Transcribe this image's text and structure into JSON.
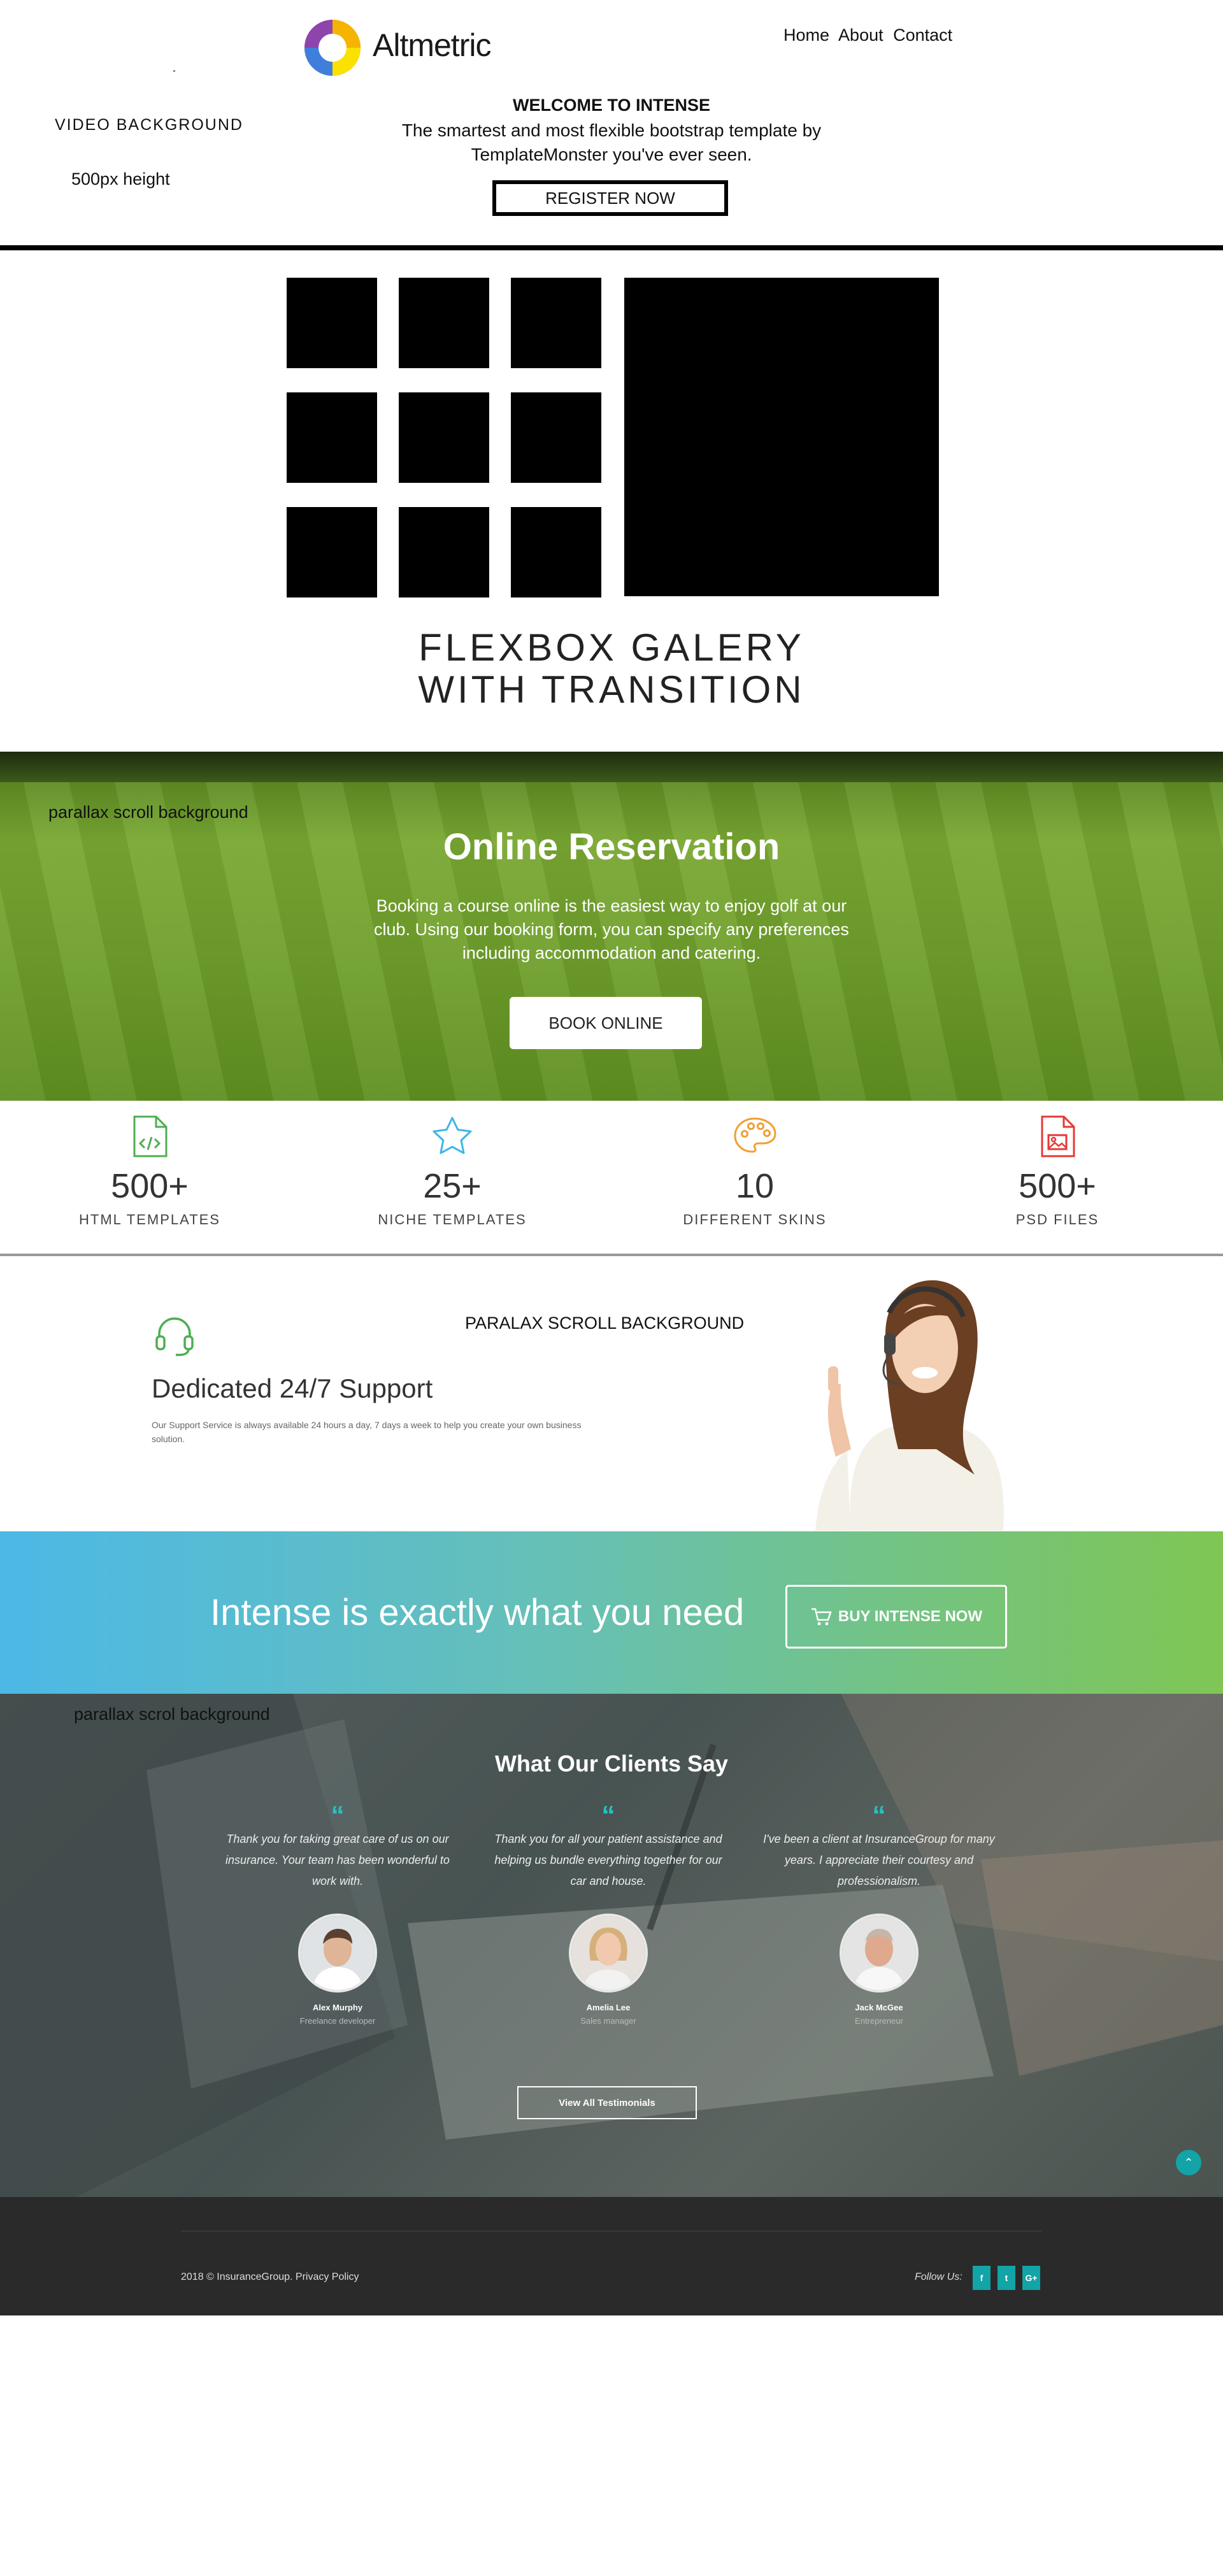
{
  "header": {
    "logo_text": "Altmetric",
    "nav": [
      "Home",
      "About",
      "Contact"
    ]
  },
  "hero": {
    "title": "WELCOME TO INTENSE",
    "subtitle": "The smartest and most flexible bootstrap template by TemplateMonster you've ever seen.",
    "register_label": "REGISTER NOW",
    "video_label": "VIDEO BACKGROUND",
    "height_label": "500px height"
  },
  "gallery": {
    "title_line1": "FLEXBOX GALERY",
    "title_line2": "WITH TRANSITION"
  },
  "reservation": {
    "note": "parallax scroll background",
    "title": "Online Reservation",
    "text": "Booking a course online is the easiest way to enjoy golf at our club. Using our booking form, you can specify any preferences including accommodation and catering.",
    "button_label": "BOOK ONLINE"
  },
  "stats": [
    {
      "icon": "code-file-icon",
      "value": "500+",
      "label": "HTML TEMPLATES",
      "color": "#4caf50"
    },
    {
      "icon": "star-icon",
      "value": "25+",
      "label": "NICHE TEMPLATES",
      "color": "#3fb5e5"
    },
    {
      "icon": "palette-icon",
      "value": "10",
      "label": "DIFFERENT SKINS",
      "color": "#f0a030"
    },
    {
      "icon": "image-file-icon",
      "value": "500+",
      "label": "PSD FILES",
      "color": "#e53935"
    }
  ],
  "support": {
    "note": "PARALAX SCROLL BACKGROUND",
    "title": "Dedicated 24/7 Support",
    "text": "Our Support Service is always available 24 hours a day, 7 days a week to help you create your own business solution."
  },
  "cta": {
    "text": "Intense is exactly what you need",
    "button_label": "BUY INTENSE NOW"
  },
  "testimonials": {
    "note": "parallax scrol background",
    "title": "What Our Clients Say",
    "items": [
      {
        "quote": "Thank you for taking great care of us on our insurance. Your team has been wonderful to work with.",
        "name": "Alex Murphy",
        "role": "Freelance developer"
      },
      {
        "quote": "Thank you for all your patient assistance and helping us bundle everything together for our car and house.",
        "name": "Amelia Lee",
        "role": "Sales manager"
      },
      {
        "quote": "I've been a client at InsuranceGroup for many years. I appreciate their courtesy and professionalism.",
        "name": "Jack McGee",
        "role": "Entrepreneur"
      }
    ],
    "view_all_label": "View All Testimonials"
  },
  "footer": {
    "copyright": "2018 © InsuranceGroup. Privacy Policy",
    "follow_label": "Follow Us:",
    "social": [
      "f",
      "t",
      "G+"
    ]
  },
  "colors": {
    "accent": "#12a4a6",
    "cta_gradient_start": "#4cb8e6",
    "cta_gradient_end": "#7fc654"
  }
}
